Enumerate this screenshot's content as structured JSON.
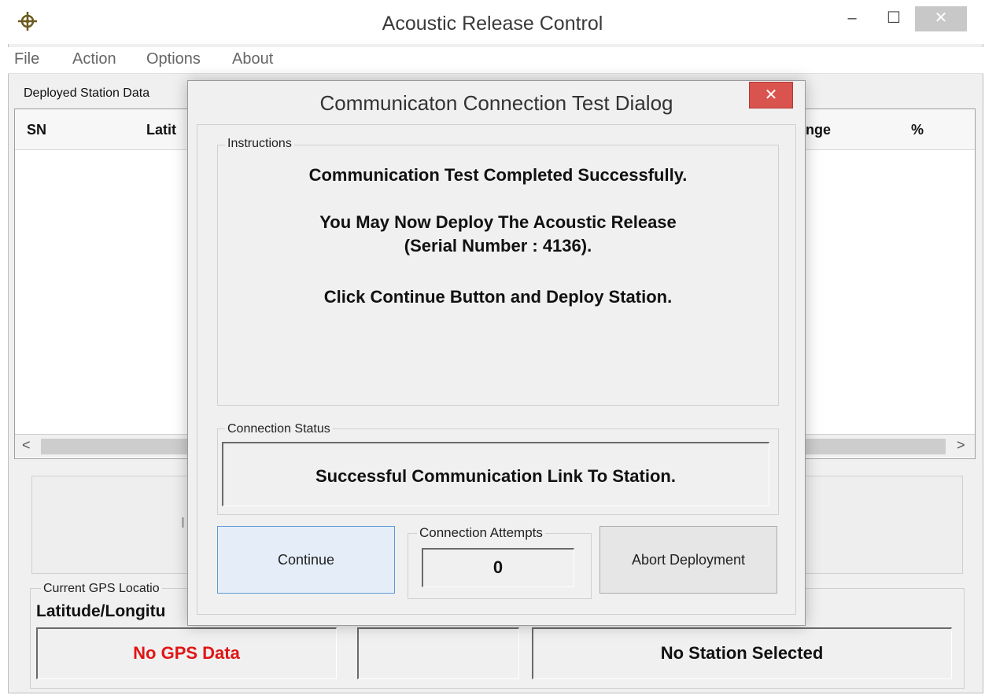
{
  "window": {
    "title": "Acoustic Release Control",
    "minimize": "–",
    "maximize": "☐",
    "close": "✕",
    "icon": "crosshair-target-icon"
  },
  "menu": {
    "items": [
      "File",
      "Action",
      "Options",
      "About"
    ]
  },
  "deployed_station": {
    "label": "Deployed Station Data",
    "columns": [
      "SN",
      "Latit",
      "nge",
      "%"
    ]
  },
  "scroll": {
    "left": "<",
    "right": ">"
  },
  "lower_panel": {
    "text": "I"
  },
  "gps": {
    "caption": "Current GPS Locatio",
    "heading": "Latitude/Longitu",
    "value": "No GPS Data",
    "middle_value": "",
    "station": "No Station Selected",
    "value_color": "#e01515"
  },
  "dialog": {
    "title": "Communicaton Connection Test Dialog",
    "close": "✕",
    "instructions_caption": "Instructions",
    "instructions": [
      "Communication Test Completed Successfully.",
      "You May Now Deploy The Acoustic Release",
      "(Serial Number : 4136).",
      "Click Continue Button and Deploy Station."
    ],
    "status_caption": "Connection Status",
    "status_text": "Successful Communication Link To Station.",
    "continue_label": "Continue",
    "attempts_caption": "Connection Attempts",
    "attempts_value": "0",
    "abort_label": "Abort Deployment",
    "close_color": "#d9534f"
  }
}
